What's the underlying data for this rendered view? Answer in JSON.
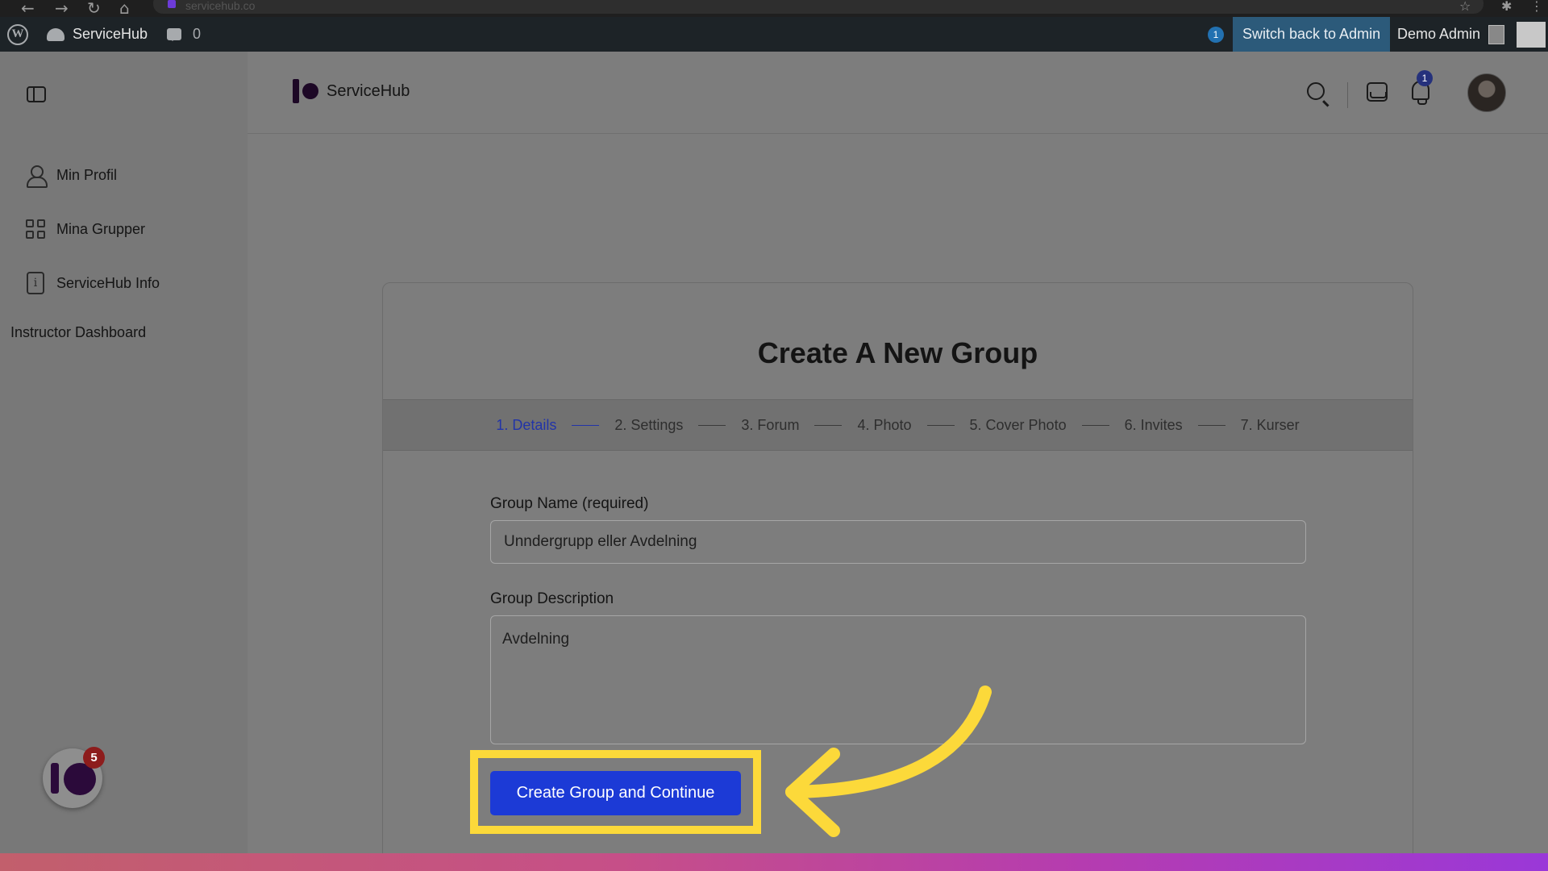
{
  "browser": {
    "url": "servicehub.co"
  },
  "admin_bar": {
    "site_name": "ServiceHub",
    "comments_count": "0",
    "notice_count": "1",
    "switch_back": "Switch back to Admin",
    "user": "Demo Admin"
  },
  "sidebar": {
    "items": [
      {
        "label": "Min Profil",
        "icon": "user-icon"
      },
      {
        "label": "Mina Grupper",
        "icon": "grid-icon"
      },
      {
        "label": "ServiceHub Info",
        "icon": "info-icon"
      }
    ],
    "instructor_dashboard": "Instructor Dashboard",
    "launcher_badge": "5"
  },
  "header": {
    "brand": "ServiceHub",
    "notification_count": "1"
  },
  "form": {
    "title": "Create A New Group",
    "steps": [
      "1. Details",
      "2. Settings",
      "3. Forum",
      "4. Photo",
      "5. Cover Photo",
      "6. Invites",
      "7. Kurser"
    ],
    "active_step": 0,
    "name_label": "Group Name (required)",
    "name_value": "Unndergrupp eller Avdelning",
    "description_label": "Group Description",
    "description_value": "Avdelning",
    "submit_label": "Create Group and Continue"
  },
  "colors": {
    "accent": "#1c3ad6",
    "highlight": "#fcd93a",
    "admin_bar": "#1d2327"
  }
}
